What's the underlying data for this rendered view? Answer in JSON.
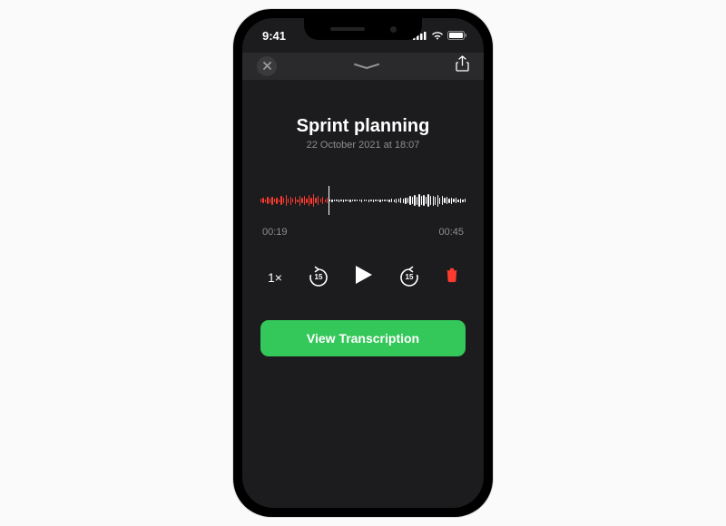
{
  "status": {
    "time": "9:41"
  },
  "recording": {
    "title": "Sprint planning",
    "date": "22 October 2021 at 18:07",
    "elapsed": "00:19",
    "duration": "00:45"
  },
  "controls": {
    "speed": "1×",
    "skip_back": "15",
    "skip_fwd": "15"
  },
  "cta": {
    "label": "View Transcription"
  },
  "colors": {
    "accent": "#34c759",
    "danger": "#ff3b30",
    "played": "#ff3b30"
  }
}
